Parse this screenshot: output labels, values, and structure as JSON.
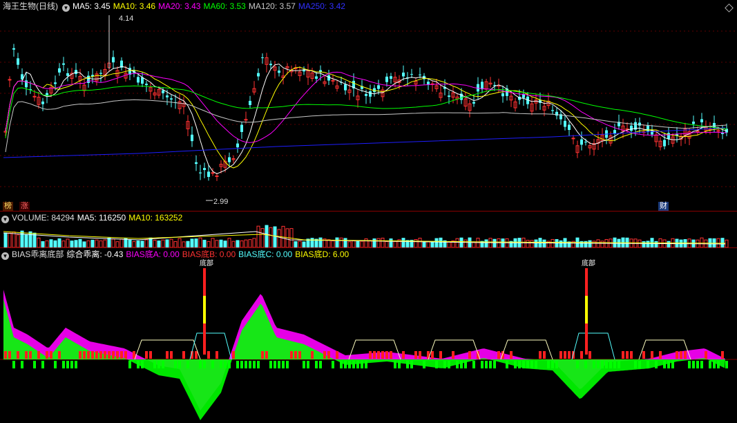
{
  "price_header": {
    "stock": "海王生物(日线)",
    "ma5": "MA5: 3.45",
    "ma10": "MA10: 3.46",
    "ma20": "MA20: 3.43",
    "ma60": "MA60: 3.53",
    "ma120": "MA120: 3.57",
    "ma250": "MA250: 3.42"
  },
  "price_labels": {
    "high": "4.14",
    "low": "2.99"
  },
  "tags": {
    "bang": "榜",
    "zhang": "涨",
    "cai": "财"
  },
  "volume_header": {
    "title": "VOLUME: 84294",
    "ma5": "MA5: 116250",
    "ma10": "MA10: 163252"
  },
  "bias_header": {
    "title": "BIAS乖离底部",
    "composite": "综合乖离: -0.43",
    "a": "BIAS底A: 0.00",
    "b": "BIAS底B: 0.00",
    "c": "BIAS底C: 0.00",
    "d": "BIAS底D: 6.00"
  },
  "bias_markers": [
    "底部",
    "底部"
  ],
  "colors": {
    "up": "#ff3232",
    "down": "#54ffff",
    "ma5": "#ffffff",
    "ma10": "#ffff00",
    "ma20": "#ff00ff",
    "ma60": "#00ff00",
    "ma120": "#c8c8c8",
    "ma250": "#1e1eff",
    "bias_green": "#00ff00",
    "bias_magenta": "#ff00ff"
  }
}
